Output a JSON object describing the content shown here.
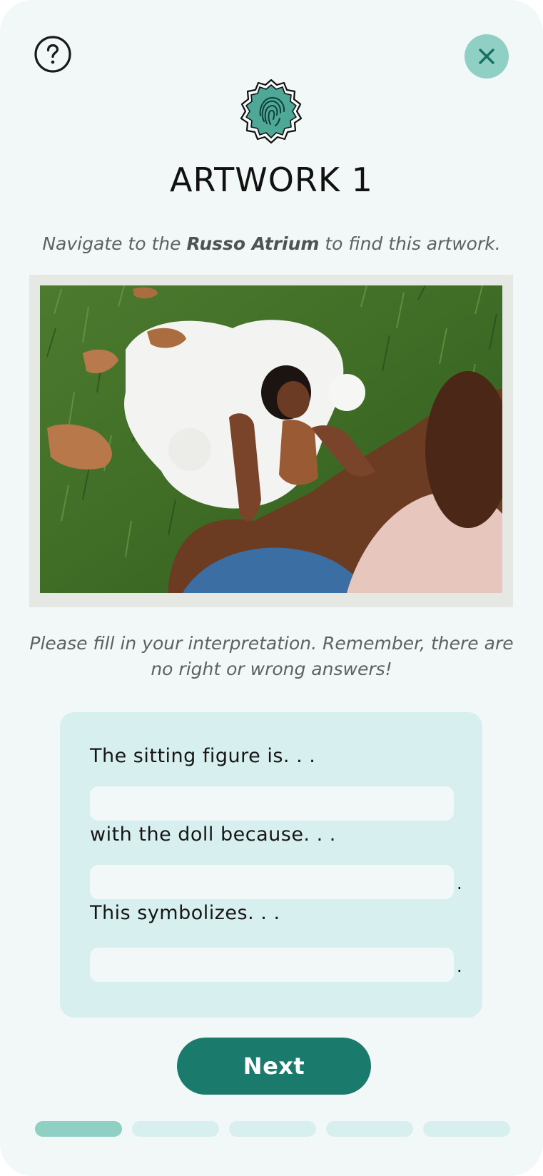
{
  "header": {
    "title": "ARTWORK 1",
    "help_icon": "question-circle-icon",
    "close_icon": "close-x-icon",
    "badge_icon": "fingerprint-badge-icon"
  },
  "instructions": {
    "prefix": "Navigate to the ",
    "location": "Russo Atrium",
    "suffix": " to find this artwork."
  },
  "artwork": {
    "description_icon": "artwork-photo"
  },
  "prompt": "Please fill in your interpretation. Remember, there are no right or wrong answers!",
  "form": {
    "fields": [
      {
        "label": "The sitting figure is. . .",
        "value": "",
        "placeholder": "",
        "trailing": ""
      },
      {
        "label": "with the doll because. . .",
        "value": "",
        "placeholder": "",
        "trailing": "."
      },
      {
        "label": "This symbolizes. . .",
        "value": "",
        "placeholder": "",
        "trailing": "."
      }
    ]
  },
  "next_button": {
    "label": "Next"
  },
  "progress": {
    "total_steps": 5,
    "current_step": 1
  },
  "colors": {
    "background": "#f2f8f8",
    "accent": "#1a7a6b",
    "accent_light": "#8fcfc4",
    "card": "#d8efef"
  }
}
